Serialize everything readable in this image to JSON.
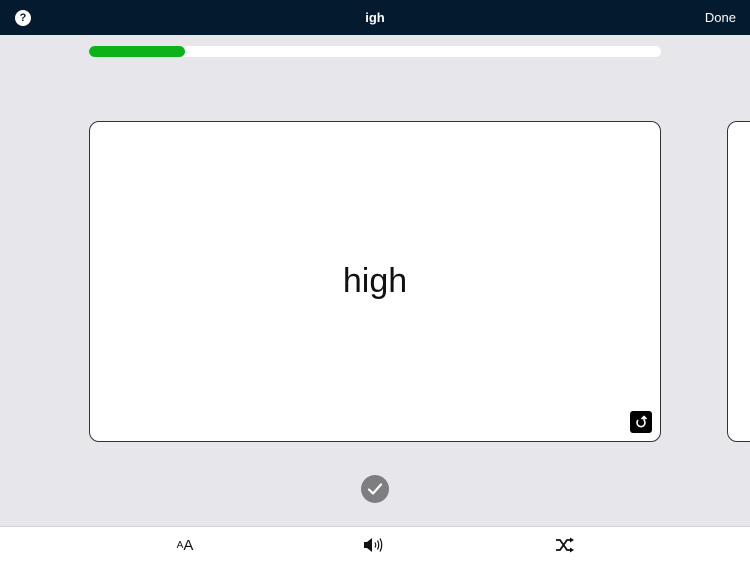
{
  "header": {
    "help_icon_glyph": "?",
    "title": "igh",
    "done_label": "Done"
  },
  "progress": {
    "fraction": 0.167,
    "color": "#0cb21a"
  },
  "card": {
    "word": "high",
    "flip_icon": "flip-arrow-icon"
  },
  "actions": {
    "mark_known_icon": "checkmark-icon"
  },
  "toolbar": {
    "font_size_small": "A",
    "font_size_big": "A",
    "sound_icon": "speaker-icon",
    "shuffle_icon": "shuffle-icon"
  }
}
